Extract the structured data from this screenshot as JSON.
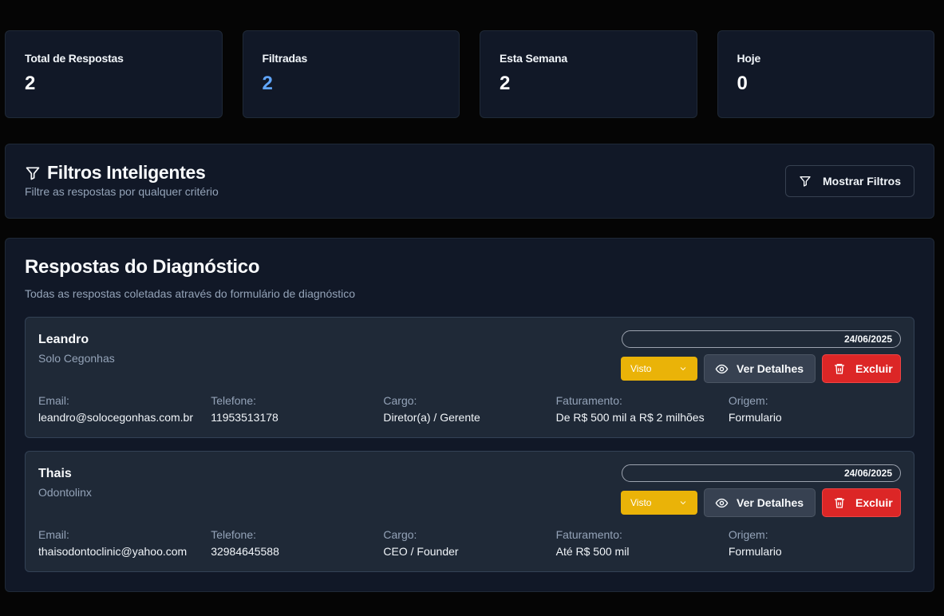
{
  "stats": [
    {
      "label": "Total de Respostas",
      "value": "2"
    },
    {
      "label": "Filtradas",
      "value": "2"
    },
    {
      "label": "Esta Semana",
      "value": "2"
    },
    {
      "label": "Hoje",
      "value": "0"
    }
  ],
  "filters": {
    "title": "Filtros Inteligentes",
    "subtitle": "Filtre as respostas por qualquer critério",
    "show_button": "Mostrar Filtros",
    "icon": "filter-icon"
  },
  "responses": {
    "title": "Respostas do Diagnóstico",
    "subtitle": "Todas as respostas coletadas através do formulário de diagnóstico",
    "labels": {
      "email": "Email:",
      "telefone": "Telefone:",
      "cargo": "Cargo:",
      "faturamento": "Faturamento:",
      "origem": "Origem:"
    },
    "actions": {
      "details": "Ver Detalhes",
      "delete": "Excluir"
    },
    "items": [
      {
        "name": "Leandro",
        "company": "Solo Cegonhas",
        "date": "24/06/2025",
        "status": "Visto",
        "email": "leandro@solocegonhas.com.br",
        "telefone": "11953513178",
        "cargo": "Diretor(a) / Gerente",
        "faturamento": "De R$ 500 mil a R$ 2 milhões",
        "origem": "Formulario"
      },
      {
        "name": "Thais",
        "company": "Odontolinx",
        "date": "24/06/2025",
        "status": "Visto",
        "email": "thaisodontoclinic@yahoo.com",
        "telefone": "32984645588",
        "cargo": "CEO / Founder",
        "faturamento": "Até R$ 500 mil",
        "origem": "Formulario"
      }
    ]
  },
  "colors": {
    "accent": "#60a5fa",
    "status_visto": "#eab308",
    "danger": "#dc2626"
  }
}
